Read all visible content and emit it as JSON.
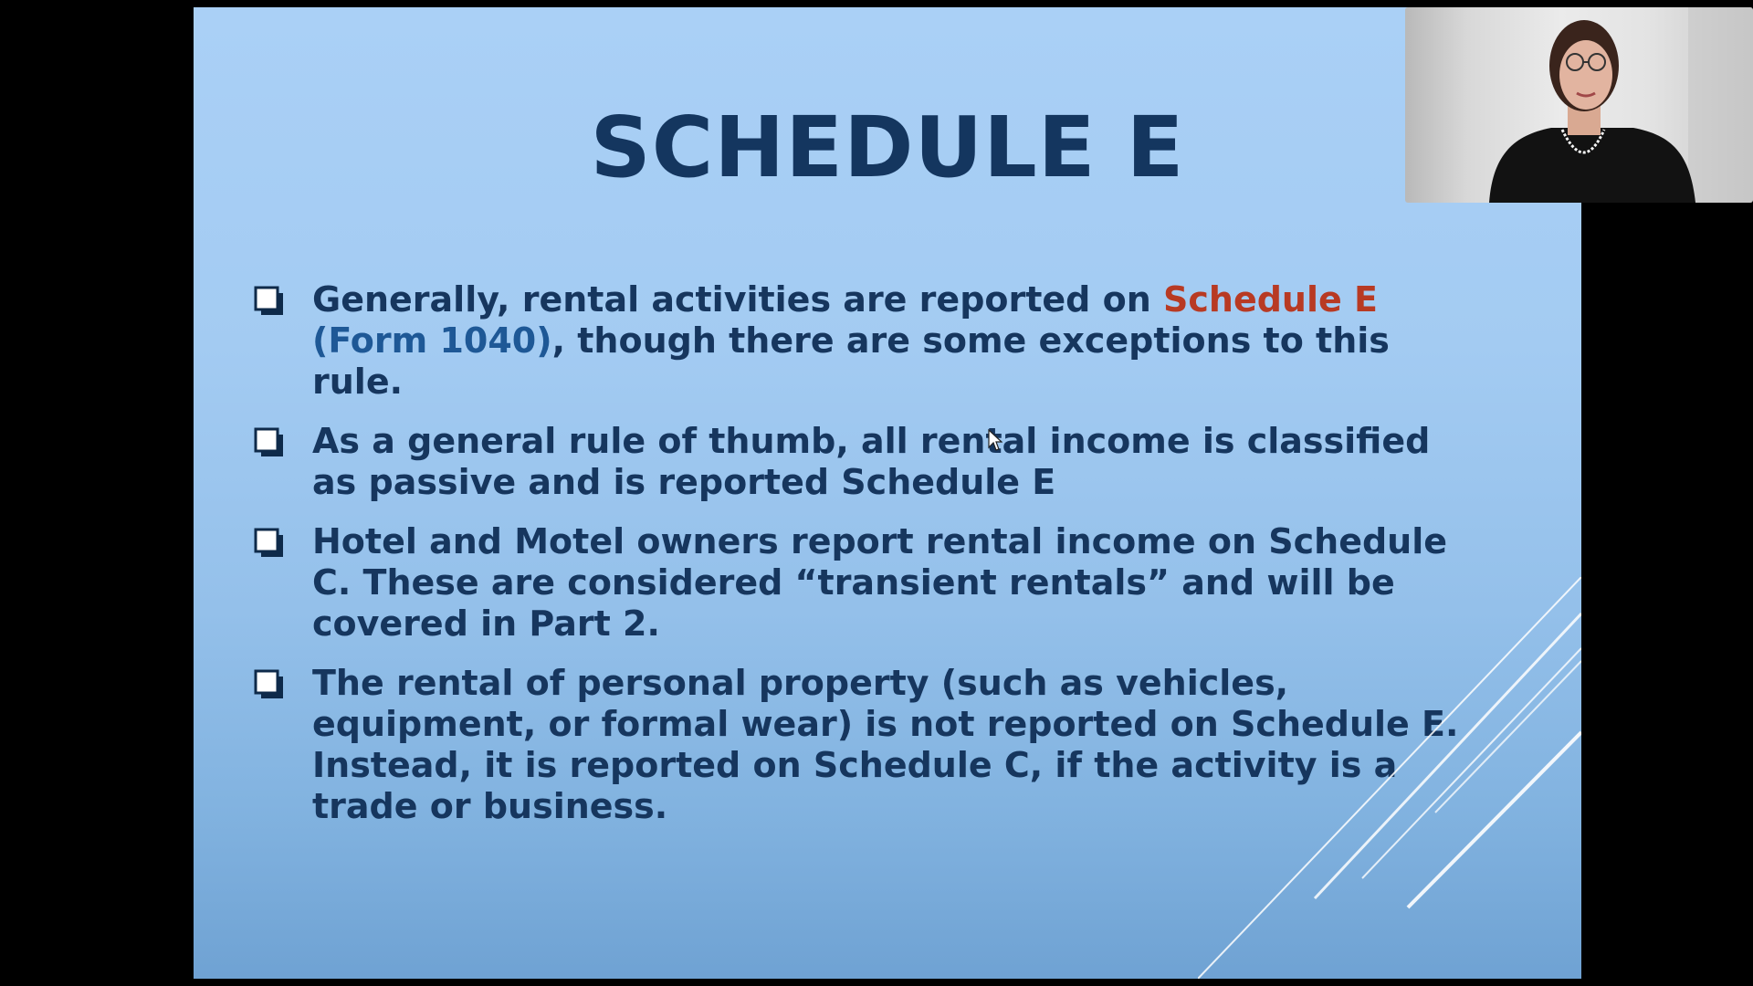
{
  "slide": {
    "title": "SCHEDULE E",
    "colors": {
      "title": "#14365f",
      "body": "#16365e",
      "accent": "#b83a23",
      "form_reference": "#1e5896",
      "background_top": "#aad0f6",
      "background_bottom": "#6fa2d3"
    },
    "bullets": [
      {
        "part1": "Generally, rental activities are reported on ",
        "accent": "Schedule E",
        "form": " (Form 1040)",
        "part2": ", though there are some exceptions to this rule."
      },
      {
        "text": "As a general rule of thumb, all rental income is classified as passive and is reported Schedule E"
      },
      {
        "text": "Hotel and Motel owners report rental income on Schedule C. These are considered “transient rentals” and will be covered in Part 2."
      },
      {
        "text": "The rental of personal property (such as vehicles, equipment, or formal wear) is not reported on Schedule E. Instead, it is reported on Schedule C, if the activity is a trade or business."
      }
    ],
    "bullet_icon": "checkbox-icon"
  },
  "webcam": {
    "icon": "presenter-video-feed"
  },
  "cursor": {
    "icon": "mouse-pointer-icon"
  }
}
